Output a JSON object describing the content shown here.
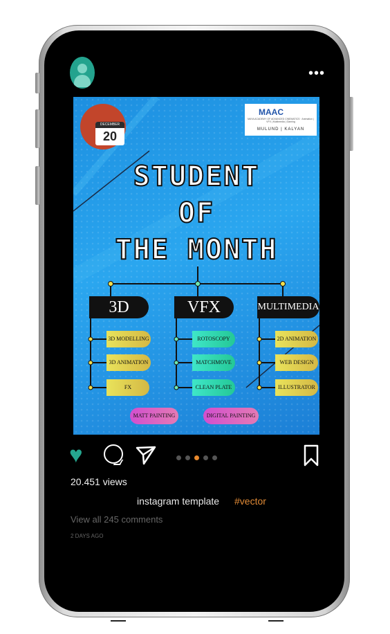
{
  "post": {
    "poster": {
      "calendar_month": "DECEMBER",
      "calendar_day": "20",
      "logo": {
        "brand": "MAAC",
        "tagline": "MAYA ACADEMY OF ADVANCED CINEMATICS · Animation | VFX | Multimedia | Gaming",
        "city": "MULUND | KALYAN"
      },
      "title": [
        "STUDENT",
        "OF",
        "THE MONTH"
      ],
      "categories": [
        {
          "label": "3D",
          "items": [
            "3D MODELLING",
            "3D ANIMATION",
            "FX"
          ]
        },
        {
          "label": "VFX",
          "items": [
            "ROTOSCOPY",
            "MATCHMOVE",
            "CLEAN PLATE"
          ]
        },
        {
          "label": "MULTIMEDIA",
          "items": [
            "2D ANIMATION",
            "WEB DESIGN",
            "ILLUSTRATOR"
          ]
        }
      ],
      "extra_items": [
        "MATT PAINTING",
        "DIGITAL PAINTING"
      ]
    },
    "views": "20.451 views",
    "caption": "instagram template",
    "hashtag": "#vector",
    "comments_link": "View all 245 comments",
    "timestamp": "2 DAYS AGO",
    "carousel": {
      "total": 5,
      "active_index": 2
    }
  },
  "icons": {
    "avatar": "user-avatar-icon",
    "more": "more-options-icon",
    "like": "heart-icon",
    "comment": "comment-icon",
    "share": "share-icon",
    "save": "bookmark-icon"
  },
  "colors": {
    "accent": "#25a68f",
    "hashtag": "#e08a36",
    "screen_bg": "#000000"
  }
}
